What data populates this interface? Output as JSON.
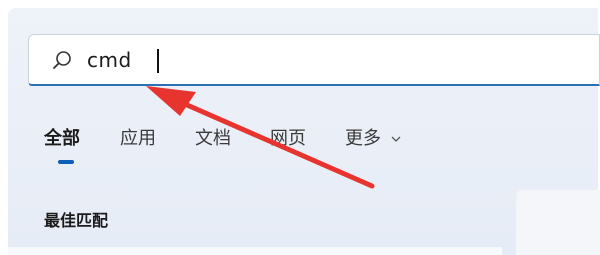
{
  "search": {
    "value": "cmd"
  },
  "tabs": [
    {
      "label": "全部",
      "active": true
    },
    {
      "label": "应用"
    },
    {
      "label": "文档"
    },
    {
      "label": "网页"
    },
    {
      "label": "更多"
    }
  ],
  "section": {
    "best_match": "最佳匹配"
  },
  "colors": {
    "accent": "#0b5fb8",
    "annotation_arrow": "#e8342f"
  },
  "icons": {
    "search": "search-icon",
    "more": "chevron-down-icon"
  }
}
